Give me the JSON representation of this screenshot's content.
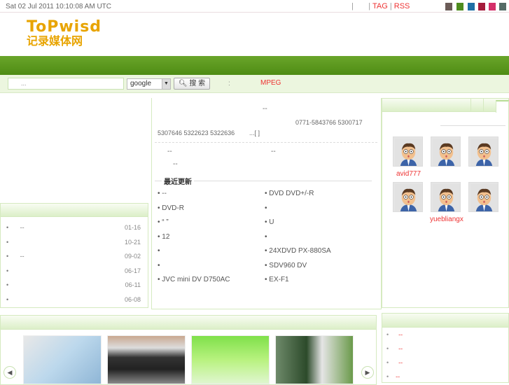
{
  "topbar": {
    "date": "Sat 02 Jul 2011 10:10:08 AM UTC",
    "sep": "|",
    "tag": "TAG",
    "rss": "RSS"
  },
  "theme_colors": [
    "#6b5b57",
    "#4e8c1e",
    "#1f6fa5",
    "#a51c3c",
    "#d4306a",
    "#556b66"
  ],
  "logo": {
    "en": "ToPwisd",
    "cn": "记录媒体网"
  },
  "search": {
    "placeholder": "...",
    "engine": "google",
    "button": "搜 索",
    "colon": ":",
    "hot": "MPEG"
  },
  "intro": {
    "title": "--",
    "phone1": "0771-5843766 5300717",
    "phone2": "5307646 5322623 5322636",
    "more": "...[ ]",
    "link1": "--",
    "link2": "--",
    "link3": "--"
  },
  "recent": {
    "title": "最近更新",
    "left": [
      "•       --",
      "•    DVD-R",
      "•  “    ”",
      "•    12",
      "•",
      "•",
      "• JVC  mini DV D750AC"
    ],
    "right": [
      "• DVD    DVD+/-R",
      "•",
      "•       U",
      "•",
      "•     24XDVD   PX-880SA",
      "•    SDV960    DV",
      "•             EX-F1"
    ]
  },
  "leftlist": [
    {
      "t": "--",
      "d": "01-16"
    },
    {
      "t": "",
      "d": "10-21"
    },
    {
      "t": "--",
      "d": "09-02"
    },
    {
      "t": "",
      "d": "06-17"
    },
    {
      "t": "",
      "d": "06-11"
    },
    {
      "t": "",
      "d": "06-08"
    }
  ],
  "members": {
    "names": [
      "avid777",
      "yuebliangx"
    ]
  },
  "botright": {
    "items": [
      "--",
      "--",
      "--",
      "--"
    ]
  },
  "carousel": {
    "prev": "◀",
    "next": "▶"
  }
}
